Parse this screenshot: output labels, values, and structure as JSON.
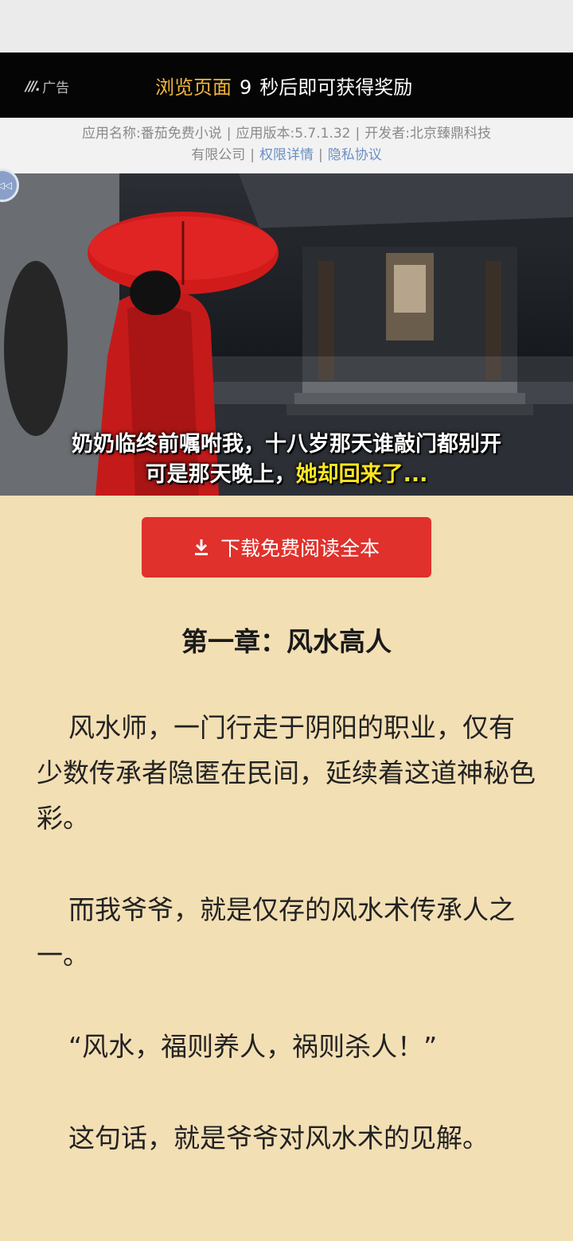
{
  "ad_bar": {
    "badge": "广告",
    "countdown_prefix": "浏览页面",
    "countdown_seconds": "9",
    "countdown_suffix": "秒后即可获得奖励"
  },
  "app_info": {
    "name": "应用名称:番茄免费小说",
    "version": "应用版本:5.7.1.32",
    "developer_part1": "开发者:北京臻鼎科技",
    "developer_part2": "有限公司",
    "permissions_link": "权限详情",
    "privacy_link": "隐私协议"
  },
  "banner": {
    "caption_line1": "奶奶临终前嘱咐我，十八岁那天谁敲门都别开",
    "caption_line2_white": "可是那天晚上，",
    "caption_line2_yellow": "她却回来了..."
  },
  "download_button": {
    "label": "下载免费阅读全本"
  },
  "chapter": {
    "title": "第一章：风水高人",
    "paragraphs": [
      "风水师，一门行走于阴阳的职业，仅有少数传承者隐匿在民间，延续着这道神秘色彩。",
      "而我爷爷，就是仅存的风水术传承人之一。",
      "“风水，福则养人，祸则杀人！”",
      "这句话，就是爷爷对风水术的见解。"
    ]
  },
  "colors": {
    "page_bg": "#f3dfb4",
    "ad_bg": "#050505",
    "countdown_highlight": "#f2b53c",
    "link": "#6b8fc3",
    "download_btn": "#e0312c",
    "caption_yellow": "#ffe522"
  }
}
